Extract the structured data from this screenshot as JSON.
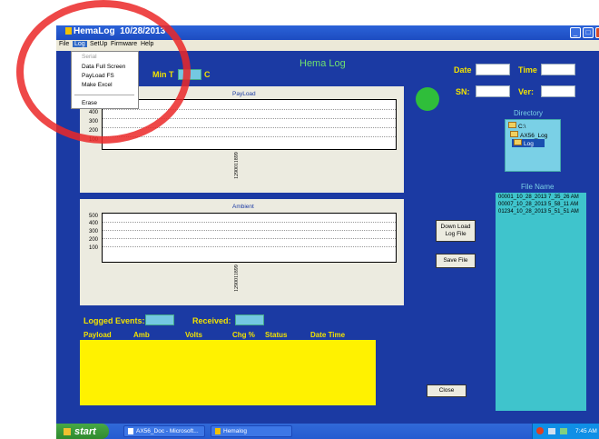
{
  "window": {
    "title": "HemaLog",
    "date": "10/28/2013"
  },
  "menu": {
    "file": "File",
    "log": "Log",
    "setup": "SetUp",
    "firmware": "Firmware",
    "help": "Help"
  },
  "log_menu": {
    "serial": "Serial",
    "data_full_screen": "Data Full Screen",
    "payload_fs": "PayLoad FS",
    "make_excel": "Make Excel",
    "erase": "Erase"
  },
  "header": {
    "min_t_label": "Min T",
    "min_t_unit": "C",
    "app_heading": "Hema Log",
    "date_label": "Date",
    "time_label": "Time",
    "sn_label": "SN:",
    "ver_label": "Ver:"
  },
  "payload_graph": {
    "title": "PayLoad",
    "ticks": [
      "400",
      "300",
      "200",
      "100"
    ],
    "x_label": "1290011899"
  },
  "ambient_graph": {
    "title": "Ambient",
    "ticks": [
      "500",
      "400",
      "300",
      "200",
      "100"
    ],
    "x_label": "1290011899"
  },
  "buttons": {
    "download": "Down Load Log File",
    "save": "Save File",
    "close": "Close"
  },
  "directory": {
    "label": "Directory",
    "items": [
      "C:\\",
      "AX56_Log",
      "Log"
    ]
  },
  "file_name": {
    "label": "File Name",
    "files": [
      "00001_10_28_2013 7_35_26 AM",
      "00007_10_28_2013 5_58_11 AM",
      "01234_10_28_2013 5_51_51 AM"
    ]
  },
  "events": {
    "logged_label": "Logged Events:",
    "received_label": "Received:"
  },
  "table": {
    "columns": [
      "Payload",
      "Amb",
      "Volts",
      "Chg %",
      "Status",
      "Date  Time"
    ]
  },
  "taskbar": {
    "start": "start",
    "task1": "AX56_Doc - Microsoft...",
    "task2": "Hemalog",
    "clock": "7:45 AM"
  },
  "colors": {
    "window_bg": "#1b3aa3",
    "annotation": "#eb2828",
    "status_light": "#2fbe3a",
    "table_bg": "#fff200"
  }
}
